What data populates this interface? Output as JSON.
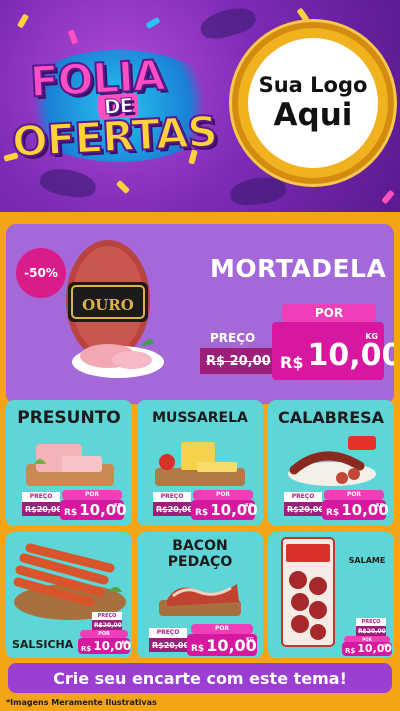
{
  "header": {
    "logo_line1": "FOLIA",
    "logo_line2": "DE",
    "logo_line3": "OFERTAS",
    "brand_line1": "Sua Logo",
    "brand_line2": "Aqui"
  },
  "hero": {
    "discount": "-50%",
    "title": "MORTADELA",
    "preco_label": "PREÇO",
    "old_price": "R$ 20,00",
    "por_label": "POR",
    "currency": "R$",
    "new_price": "10,00",
    "unit": "KG",
    "brand_text": "OURO"
  },
  "tiles": [
    {
      "title": "PRESUNTO",
      "preco_label": "PREÇO",
      "old_price": "R$20,00",
      "por_label": "POR",
      "currency": "R$",
      "new_price": "10,00",
      "unit": "KG"
    },
    {
      "title": "MUSSARELA",
      "preco_label": "PREÇO",
      "old_price": "R$20,00",
      "por_label": "POR",
      "currency": "R$",
      "new_price": "10,00",
      "unit": "KG"
    },
    {
      "title": "CALABRESA",
      "preco_label": "PREÇO",
      "old_price": "R$20,00",
      "por_label": "POR",
      "currency": "R$",
      "new_price": "10,00",
      "unit": "KG"
    },
    {
      "title": "SALSICHA",
      "preco_label": "PREÇO",
      "old_price": "R$20,00",
      "por_label": "POR",
      "currency": "R$",
      "new_price": "10,00",
      "unit": "KG"
    },
    {
      "title_line1": "BACON",
      "title_line2": "PEDAÇO",
      "preco_label": "PREÇO",
      "old_price": "R$20,00",
      "por_label": "POR",
      "currency": "R$",
      "new_price": "10,00",
      "unit": "KG"
    },
    {
      "title": "SALAME",
      "preco_label": "PREÇO",
      "old_price": "R$20,00",
      "por_label": "POR",
      "currency": "R$",
      "new_price": "10,00",
      "unit": "UN"
    }
  ],
  "cta": "Crie seu encarte com este tema!",
  "footnote": "*Imagens Meramente Ilustrativas",
  "colors": {
    "purple": "#7d2bb7",
    "orange": "#f6a417",
    "magenta": "#d7179f",
    "pink": "#ef3fb8",
    "lilac": "#a468d9",
    "teal": "#5ed5d6"
  }
}
